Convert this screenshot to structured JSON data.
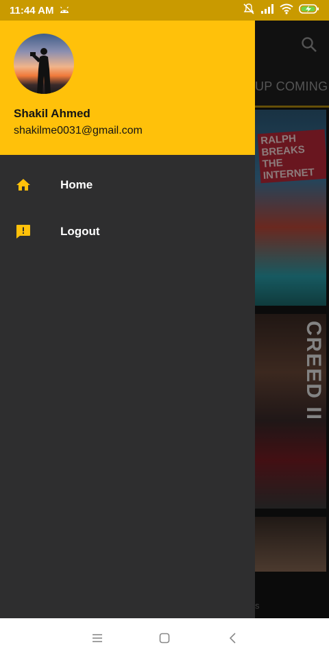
{
  "status_bar": {
    "time": "11:44 AM",
    "icons": [
      "android-notification-icon",
      "mute-icon",
      "signal-icon",
      "wifi-icon",
      "battery-charging-icon"
    ]
  },
  "background": {
    "tab_label": "UP COMING",
    "posters": [
      {
        "title": "RALPH BREAKS THE INTERNET"
      },
      {
        "title": "CREED II"
      },
      {
        "title": ""
      }
    ],
    "bottom_label": "s"
  },
  "drawer": {
    "user": {
      "name": "Shakil Ahmed",
      "email": "shakilme0031@gmail.com"
    },
    "menu": [
      {
        "label": "Home",
        "icon": "home-icon"
      },
      {
        "label": "Logout",
        "icon": "feedback-icon"
      }
    ]
  },
  "colors": {
    "accent": "#ffc10a",
    "drawer_bg": "#2e2e2f",
    "status_bar": "#c99a00"
  },
  "nav_bar": {
    "buttons": [
      "menu-icon",
      "home-square-icon",
      "back-icon"
    ]
  }
}
